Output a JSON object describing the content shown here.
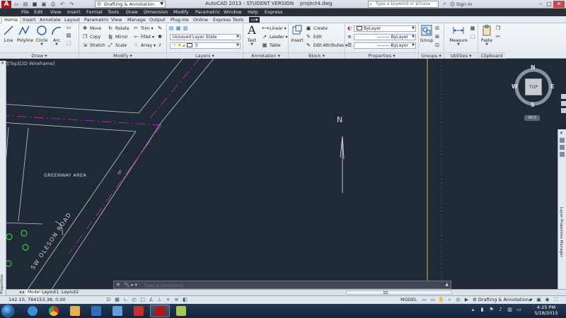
{
  "titlebar": {
    "logo": "A",
    "workspace": "Drafting & Annotation",
    "title": "AutoCAD 2013 - STUDENT VERSION    project4.dwg",
    "search_placeholder": "Type a keyword or phrase",
    "signin": "Sign In"
  },
  "menu": [
    "File",
    "Edit",
    "View",
    "Insert",
    "Format",
    "Tools",
    "Draw",
    "Dimension",
    "Modify",
    "Parametric",
    "Window",
    "Help",
    "Express"
  ],
  "tabs": [
    "Home",
    "Insert",
    "Annotate",
    "Layout",
    "Parametric",
    "View",
    "Manage",
    "Output",
    "Plug-ins",
    "Online",
    "Express Tools"
  ],
  "ribbon": {
    "draw": {
      "title": "Draw",
      "buttons": [
        "Line",
        "Polyline",
        "Circle",
        "Arc"
      ]
    },
    "modify": {
      "title": "Modify",
      "items": [
        "Move",
        "Rotate",
        "Trim",
        "Copy",
        "Mirror",
        "Fillet",
        "Stretch",
        "Scale",
        "Array"
      ]
    },
    "layers": {
      "title": "Layers",
      "state": "Unsaved Layer State",
      "current": "0"
    },
    "annotation": {
      "title": "Annotation",
      "text": "Text",
      "items": [
        "Linear",
        "Leader",
        "Table"
      ]
    },
    "block": {
      "title": "Block",
      "insert": "Insert",
      "items": [
        "Create",
        "Edit",
        "Edit Attributes"
      ]
    },
    "properties": {
      "title": "Properties",
      "color": "ByLayer",
      "linetype": "ByLayer",
      "lineweight": "ByLayer"
    },
    "groups": {
      "title": "Groups",
      "button": "Group"
    },
    "utilities": {
      "title": "Utilities",
      "button": "Measure"
    },
    "clipboard": {
      "title": "Clipboard",
      "button": "Paste"
    }
  },
  "viewport": {
    "label": "[–][Top][2D Wireframe]",
    "greenway": "GREENWAY AREA",
    "road": "SW OLESON ROAD",
    "north": "N",
    "road_dim": "30'"
  },
  "viewcube": {
    "n": "N",
    "s": "S",
    "e": "E",
    "w": "W",
    "face": "TOP",
    "wcs": "WCS"
  },
  "right_palette": "Layer Properties Manager",
  "left_palette": "Properties",
  "command": {
    "placeholder": "Type a command"
  },
  "layout_tabs": [
    "Model",
    "Layout1",
    "Layout2"
  ],
  "status": {
    "coords": "142  10, 784153.38, 0.00",
    "model": "MODEL",
    "workspace": "Drafting & Annotation"
  },
  "taskbar": {
    "time": "4:25 PM",
    "date": "5/18/2015"
  },
  "colors": {
    "canvas": "#1f2a36",
    "magenta_line": "#c12bc4",
    "road_line": "#c9c9c9",
    "green_circle": "#2fd13a",
    "yellow_line": "#c6c43a"
  }
}
